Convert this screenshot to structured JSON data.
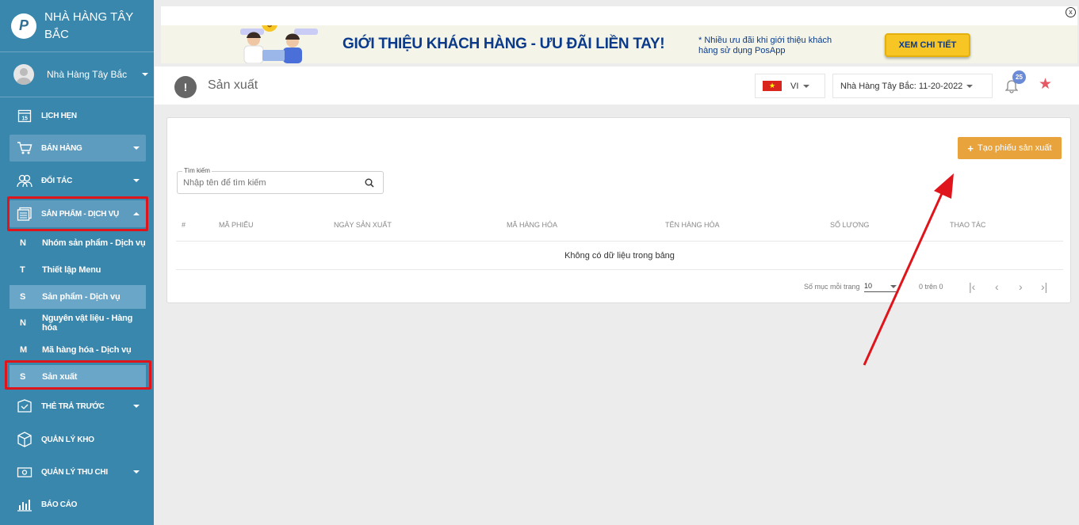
{
  "brand": {
    "name": "NHÀ HÀNG TÂY BẮC",
    "logo": "P"
  },
  "user": {
    "name": "Nhà Hàng Tây Bắc"
  },
  "nav": [
    {
      "label": "LỊCH HẸN",
      "icon": "calendar-icon"
    },
    {
      "label": "BÁN HÀNG",
      "icon": "cart-icon"
    },
    {
      "label": "ĐỐI TÁC",
      "icon": "partners-icon"
    },
    {
      "label": "SẢN PHẨM - DỊCH VỤ",
      "icon": "product-icon"
    },
    {
      "label": "THẺ TRẢ TRƯỚC",
      "icon": "prepaid-card-icon"
    },
    {
      "label": "QUẢN LÝ KHO",
      "icon": "box-icon"
    },
    {
      "label": "QUẢN LÝ THU CHI",
      "icon": "money-icon"
    },
    {
      "label": "BÁO CÁO",
      "icon": "report-chart-icon"
    }
  ],
  "subnav": [
    {
      "letter": "N",
      "label": "Nhóm sản phẩm - Dịch vụ"
    },
    {
      "letter": "T",
      "label": "Thiết lập Menu"
    },
    {
      "letter": "S",
      "label": "Sản phẩm - Dịch vụ"
    },
    {
      "letter": "N",
      "label": "Nguyên vật liệu - Hàng hóa"
    },
    {
      "letter": "M",
      "label": "Mã hàng hóa - Dịch vụ"
    },
    {
      "letter": "S",
      "label": "Sản xuất"
    }
  ],
  "banner": {
    "title": "GIỚI THIỆU KHÁCH HÀNG - ƯU ĐÃI LIỀN TAY!",
    "note": "* Nhiều ưu đãi khi giới thiệu khách hàng sử dụng PosApp",
    "button": "XEM CHI TIẾT",
    "close": "x"
  },
  "header": {
    "page_icon": "!",
    "title": "Sản xuất",
    "language": "VI",
    "store": "Nhà Hàng Tây Bắc: 11-20-2022",
    "notification_count": "25",
    "star": "★"
  },
  "toolbar": {
    "create_label": "Tạo phiếu sản xuất"
  },
  "search": {
    "label": "Tìm kiếm",
    "placeholder": "Nhập tên để tìm kiếm"
  },
  "table": {
    "columns": [
      "#",
      "MÃ PHIẾU",
      "NGÀY SẢN XUẤT",
      "MÃ HÀNG HÓA",
      "TÊN HÀNG HÓA",
      "SỐ LƯỢNG",
      "THAO TÁC"
    ],
    "empty_text": "Không có dữ liệu trong bảng"
  },
  "pagination": {
    "per_page_label": "Số mục mỗi trang",
    "per_page": "10",
    "range": "0 trên 0",
    "first": "|‹",
    "prev": "‹",
    "next": "›",
    "last": "›|"
  },
  "colors": {
    "sidebar": "#3a87ad",
    "accent": "#e8a33d",
    "annotation": "#e0151b"
  }
}
